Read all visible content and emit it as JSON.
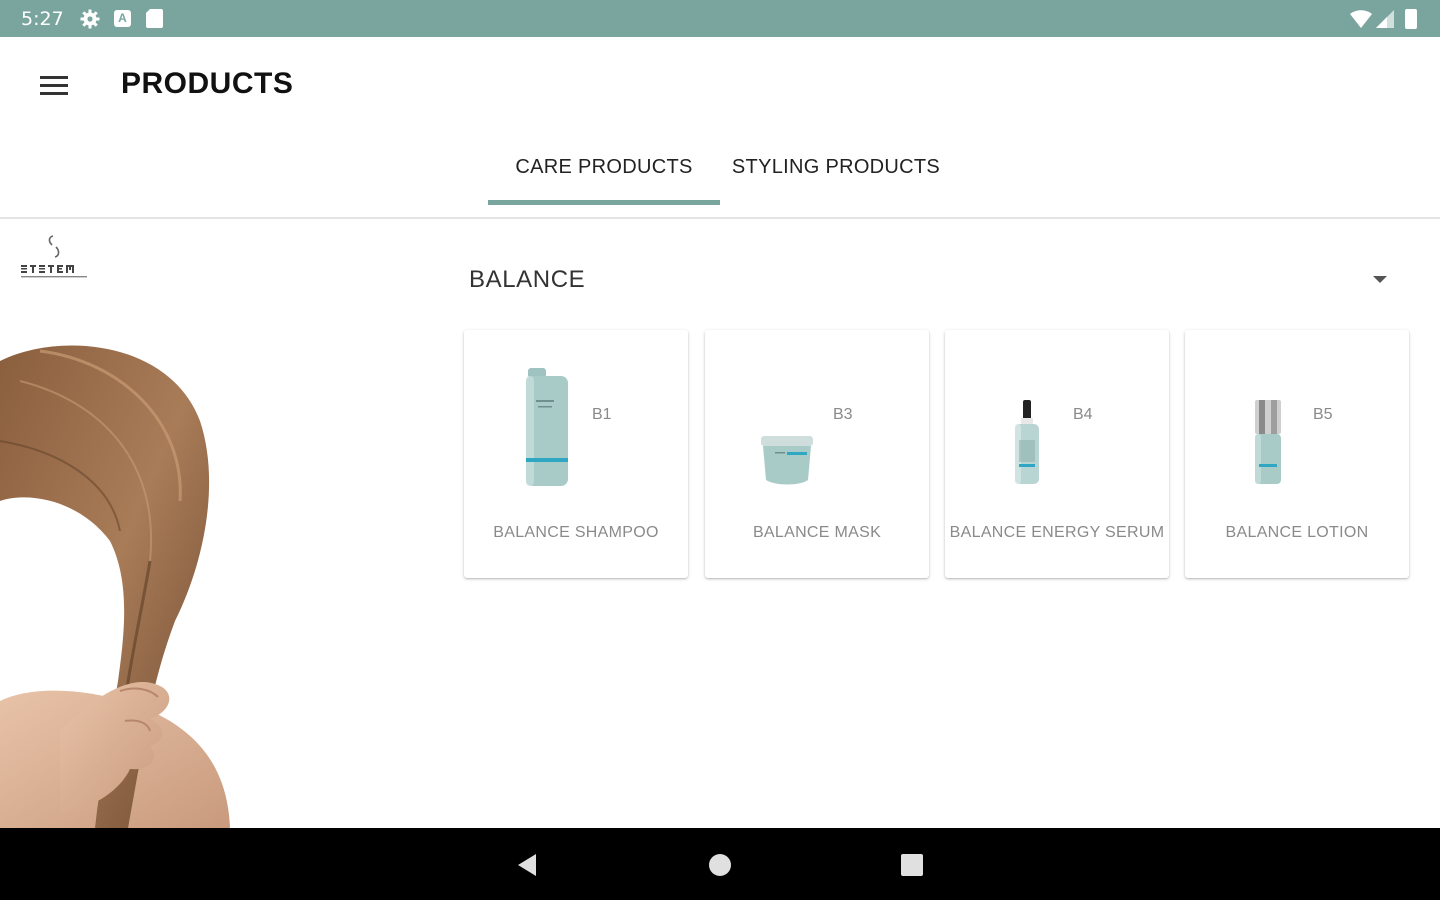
{
  "status_bar": {
    "time": "5:27",
    "icons": [
      "gear-icon",
      "a-icon",
      "sd-card-icon",
      "wifi-icon",
      "signal-icon",
      "battery-icon"
    ],
    "color": "#7aa59e"
  },
  "app_bar": {
    "title": "PRODUCTS",
    "menu_icon": "hamburger-menu-icon"
  },
  "tabs": [
    {
      "label": "CARE PRODUCTS",
      "selected": true
    },
    {
      "label": "STYLING PRODUCTS",
      "selected": false
    }
  ],
  "accent_color": "#7aa59e",
  "category": {
    "selected": "BALANCE",
    "icon": "dropdown-arrow-icon"
  },
  "products": [
    {
      "code": "B1",
      "name": "BALANCE SHAMPOO",
      "image": "bottle"
    },
    {
      "code": "B3",
      "name": "BALANCE MASK",
      "image": "jar"
    },
    {
      "code": "B4",
      "name": "BALANCE ENERGY SERUM",
      "image": "dropper"
    },
    {
      "code": "B5",
      "name": "BALANCE LOTION",
      "image": "pump"
    }
  ],
  "nav_bar": {
    "buttons": [
      "back-icon",
      "home-icon",
      "recents-icon"
    ]
  }
}
